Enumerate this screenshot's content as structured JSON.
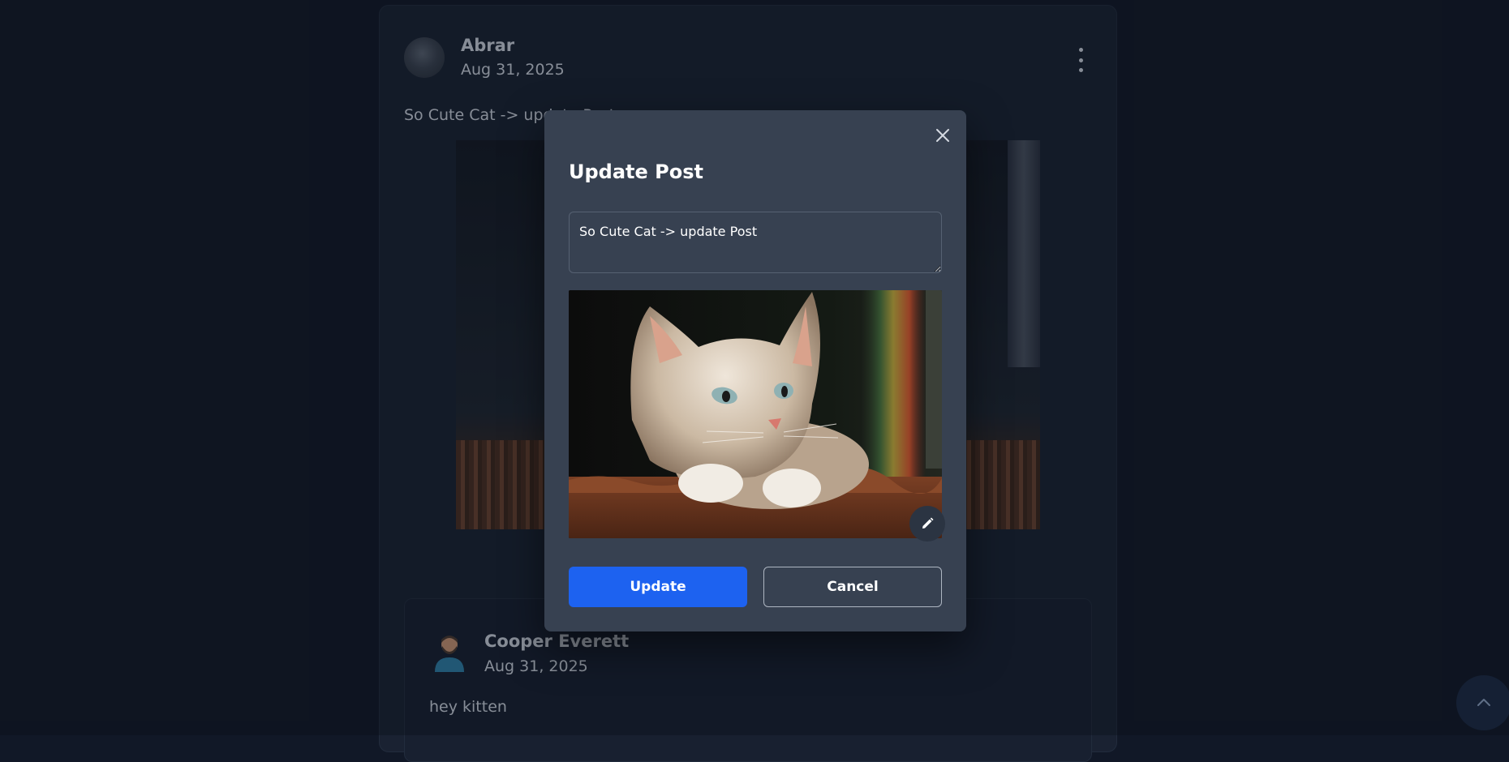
{
  "post": {
    "author": "Abrar",
    "date": "Aug 31, 2025",
    "text": "So Cute Cat -> update Post"
  },
  "comment": {
    "author": "Cooper Everett",
    "date": "Aug 31, 2025",
    "text": "hey kitten"
  },
  "modal": {
    "title": "Update Post",
    "textarea_value": "So Cute Cat -> update Post",
    "update_label": "Update",
    "cancel_label": "Cancel"
  },
  "colors": {
    "background": "#111827",
    "modal": "#374151",
    "primary": "#1d62f0"
  },
  "icons": {
    "close": "close-icon",
    "menu": "more-vertical-icon",
    "edit": "pencil-icon",
    "scroll_top": "chevron-up-icon"
  }
}
